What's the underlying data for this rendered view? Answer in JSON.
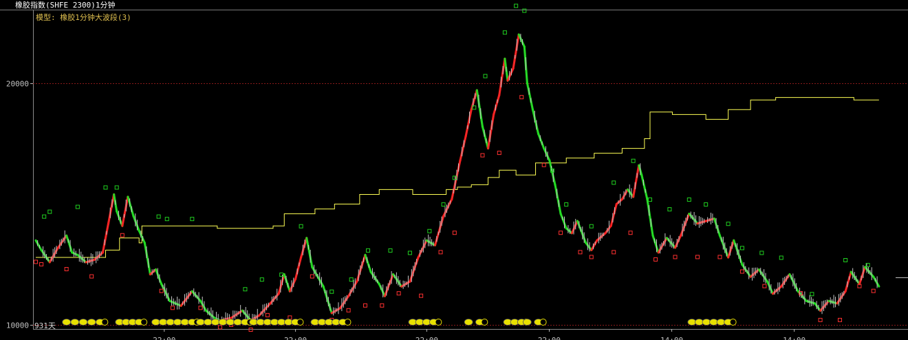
{
  "window_title": "橡胶指数(SHFE 2300)1分钟",
  "model_label": "模型: 橡胶1分钟大波段(3)",
  "days_label": "931天",
  "colors": {
    "background": "#000000",
    "price": "#c8c8c8",
    "ma": "#ffff55",
    "up_bar": "#ff2020",
    "down_bar": "#20e020",
    "grid": "#8b1a1a",
    "axis_text": "#c0c0c0",
    "signal": "#e0e000",
    "marker_up": "#20d020",
    "marker_down": "#ff3030",
    "title_text": "#ffffff",
    "model_text": "#e0c050"
  },
  "chart_data": {
    "type": "line",
    "ylim": [
      9900,
      23000
    ],
    "yticks": [
      10000,
      20000
    ],
    "xticks": [
      "22:00",
      "22:00",
      "22:00",
      "22:00",
      "14:00",
      "14:00"
    ],
    "grid": true,
    "series": [
      {
        "key": "price",
        "points": [
          [
            0,
            13500
          ],
          [
            4,
            13100
          ],
          [
            10,
            12600
          ],
          [
            16,
            13200
          ],
          [
            22,
            13700
          ],
          [
            26,
            13000
          ],
          [
            30,
            12900
          ],
          [
            36,
            12600
          ],
          [
            42,
            12700
          ],
          [
            48,
            13000
          ],
          [
            52,
            14200
          ],
          [
            56,
            15400
          ],
          [
            58,
            14700
          ],
          [
            62,
            14100
          ],
          [
            66,
            15300
          ],
          [
            70,
            14500
          ],
          [
            74,
            13900
          ],
          [
            78,
            13400
          ],
          [
            82,
            12100
          ],
          [
            86,
            12300
          ],
          [
            90,
            11700
          ],
          [
            96,
            11000
          ],
          [
            104,
            10800
          ],
          [
            112,
            11400
          ],
          [
            118,
            11000
          ],
          [
            122,
            10600
          ],
          [
            128,
            10300
          ],
          [
            132,
            10200
          ],
          [
            140,
            10300
          ],
          [
            148,
            10600
          ],
          [
            154,
            10200
          ],
          [
            160,
            10400
          ],
          [
            168,
            10900
          ],
          [
            174,
            11300
          ],
          [
            178,
            12100
          ],
          [
            182,
            11400
          ],
          [
            186,
            11900
          ],
          [
            190,
            12800
          ],
          [
            194,
            13600
          ],
          [
            198,
            12400
          ],
          [
            206,
            11600
          ],
          [
            212,
            10500
          ],
          [
            218,
            10700
          ],
          [
            224,
            11200
          ],
          [
            230,
            11800
          ],
          [
            236,
            12900
          ],
          [
            240,
            12200
          ],
          [
            246,
            11700
          ],
          [
            250,
            11200
          ],
          [
            256,
            12100
          ],
          [
            262,
            11600
          ],
          [
            268,
            11800
          ],
          [
            274,
            12800
          ],
          [
            280,
            13500
          ],
          [
            286,
            13300
          ],
          [
            292,
            14500
          ],
          [
            298,
            15200
          ],
          [
            304,
            16800
          ],
          [
            308,
            17800
          ],
          [
            312,
            18900
          ],
          [
            316,
            19700
          ],
          [
            320,
            18200
          ],
          [
            324,
            17300
          ],
          [
            328,
            18700
          ],
          [
            332,
            19500
          ],
          [
            336,
            21000
          ],
          [
            338,
            20100
          ],
          [
            342,
            20600
          ],
          [
            346,
            22000
          ],
          [
            350,
            21500
          ],
          [
            352,
            20000
          ],
          [
            356,
            18900
          ],
          [
            360,
            17900
          ],
          [
            364,
            17300
          ],
          [
            368,
            16800
          ],
          [
            372,
            15800
          ],
          [
            376,
            14600
          ],
          [
            380,
            14000
          ],
          [
            384,
            13800
          ],
          [
            388,
            14300
          ],
          [
            394,
            13400
          ],
          [
            398,
            13100
          ],
          [
            402,
            13500
          ],
          [
            408,
            13800
          ],
          [
            412,
            14100
          ],
          [
            416,
            15000
          ],
          [
            420,
            15200
          ],
          [
            424,
            15600
          ],
          [
            428,
            15300
          ],
          [
            432,
            16600
          ],
          [
            434,
            16200
          ],
          [
            438,
            15200
          ],
          [
            442,
            13700
          ],
          [
            446,
            13000
          ],
          [
            452,
            13600
          ],
          [
            458,
            13200
          ],
          [
            462,
            13700
          ],
          [
            468,
            14600
          ],
          [
            474,
            14200
          ],
          [
            480,
            14300
          ],
          [
            486,
            14400
          ],
          [
            490,
            13700
          ],
          [
            496,
            12800
          ],
          [
            500,
            13500
          ],
          [
            506,
            12500
          ],
          [
            512,
            12000
          ],
          [
            518,
            12300
          ],
          [
            524,
            11800
          ],
          [
            528,
            11300
          ],
          [
            534,
            11600
          ],
          [
            540,
            12100
          ],
          [
            546,
            11400
          ],
          [
            552,
            11000
          ],
          [
            558,
            10900
          ],
          [
            562,
            10600
          ],
          [
            568,
            11000
          ],
          [
            574,
            10900
          ],
          [
            580,
            11400
          ],
          [
            584,
            12200
          ],
          [
            590,
            11700
          ],
          [
            594,
            12400
          ],
          [
            600,
            12000
          ],
          [
            604,
            11600
          ]
        ]
      },
      {
        "key": "ma",
        "points": [
          [
            0,
            12800
          ],
          [
            40,
            12800
          ],
          [
            50,
            13100
          ],
          [
            60,
            13600
          ],
          [
            74,
            13400
          ],
          [
            76,
            14100
          ],
          [
            100,
            14100
          ],
          [
            130,
            14000
          ],
          [
            170,
            14100
          ],
          [
            178,
            14600
          ],
          [
            200,
            14800
          ],
          [
            214,
            15000
          ],
          [
            232,
            15400
          ],
          [
            246,
            15600
          ],
          [
            270,
            15400
          ],
          [
            294,
            15600
          ],
          [
            302,
            15700
          ],
          [
            312,
            15800
          ],
          [
            324,
            16100
          ],
          [
            332,
            16400
          ],
          [
            344,
            16200
          ],
          [
            352,
            16200
          ],
          [
            358,
            16700
          ],
          [
            380,
            16900
          ],
          [
            400,
            17100
          ],
          [
            420,
            17300
          ],
          [
            436,
            17700
          ],
          [
            440,
            18800
          ],
          [
            456,
            18700
          ],
          [
            480,
            18500
          ],
          [
            496,
            18900
          ],
          [
            512,
            19300
          ],
          [
            530,
            19400
          ],
          [
            560,
            19400
          ],
          [
            586,
            19300
          ],
          [
            604,
            19300
          ]
        ]
      }
    ],
    "signals_top": [
      [
        6,
        14300
      ],
      [
        10,
        14500
      ],
      [
        30,
        14700
      ],
      [
        50,
        15500
      ],
      [
        58,
        15500
      ],
      [
        88,
        14300
      ],
      [
        94,
        14200
      ],
      [
        112,
        14200
      ],
      [
        150,
        11300
      ],
      [
        162,
        11700
      ],
      [
        176,
        11900
      ],
      [
        190,
        13900
      ],
      [
        212,
        11200
      ],
      [
        226,
        11700
      ],
      [
        238,
        12900
      ],
      [
        254,
        12900
      ],
      [
        268,
        12800
      ],
      [
        282,
        13700
      ],
      [
        292,
        14800
      ],
      [
        300,
        15900
      ],
      [
        314,
        18800
      ],
      [
        322,
        20100
      ],
      [
        336,
        21900
      ],
      [
        344,
        23000
      ],
      [
        350,
        22800
      ],
      [
        370,
        16200
      ],
      [
        380,
        14800
      ],
      [
        398,
        13900
      ],
      [
        414,
        15700
      ],
      [
        428,
        16600
      ],
      [
        440,
        15000
      ],
      [
        454,
        14600
      ],
      [
        468,
        15000
      ],
      [
        480,
        14800
      ],
      [
        496,
        14000
      ],
      [
        506,
        13000
      ],
      [
        520,
        12800
      ],
      [
        534,
        12600
      ],
      [
        556,
        11100
      ],
      [
        580,
        12500
      ],
      [
        596,
        12300
      ]
    ],
    "signals_bottom": [
      [
        0,
        12800
      ],
      [
        4,
        12700
      ],
      [
        22,
        12500
      ],
      [
        40,
        12200
      ],
      [
        62,
        13900
      ],
      [
        90,
        11600
      ],
      [
        98,
        10900
      ],
      [
        118,
        10900
      ],
      [
        132,
        10100
      ],
      [
        140,
        10200
      ],
      [
        154,
        10000
      ],
      [
        166,
        10600
      ],
      [
        182,
        10500
      ],
      [
        198,
        12200
      ],
      [
        212,
        10400
      ],
      [
        224,
        10800
      ],
      [
        236,
        11000
      ],
      [
        248,
        11000
      ],
      [
        260,
        11500
      ],
      [
        276,
        11400
      ],
      [
        290,
        13200
      ],
      [
        300,
        14000
      ],
      [
        320,
        17200
      ],
      [
        332,
        17300
      ],
      [
        348,
        19600
      ],
      [
        364,
        16800
      ],
      [
        376,
        14000
      ],
      [
        390,
        13200
      ],
      [
        398,
        13000
      ],
      [
        414,
        13200
      ],
      [
        426,
        14000
      ],
      [
        444,
        12900
      ],
      [
        458,
        13000
      ],
      [
        474,
        13000
      ],
      [
        490,
        13000
      ],
      [
        506,
        12400
      ],
      [
        522,
        11800
      ],
      [
        548,
        11500
      ],
      [
        562,
        10400
      ],
      [
        576,
        10400
      ],
      [
        590,
        11800
      ],
      [
        600,
        11600
      ]
    ],
    "bottom_signals": [
      [
        22,
        46,
        "#e8e000"
      ],
      [
        60,
        74,
        "#e8e000"
      ],
      [
        86,
        112,
        "#e8e000"
      ],
      [
        118,
        150,
        "#e8e000"
      ],
      [
        156,
        186,
        "#e8e000"
      ],
      [
        200,
        220,
        "#e8e000"
      ],
      [
        270,
        285,
        "#e8e000"
      ],
      [
        310,
        318,
        "#e8e000"
      ],
      [
        338,
        348,
        "#e8e000"
      ],
      [
        352,
        360,
        "#e8e000"
      ],
      [
        470,
        496,
        "#e8e000"
      ]
    ]
  }
}
